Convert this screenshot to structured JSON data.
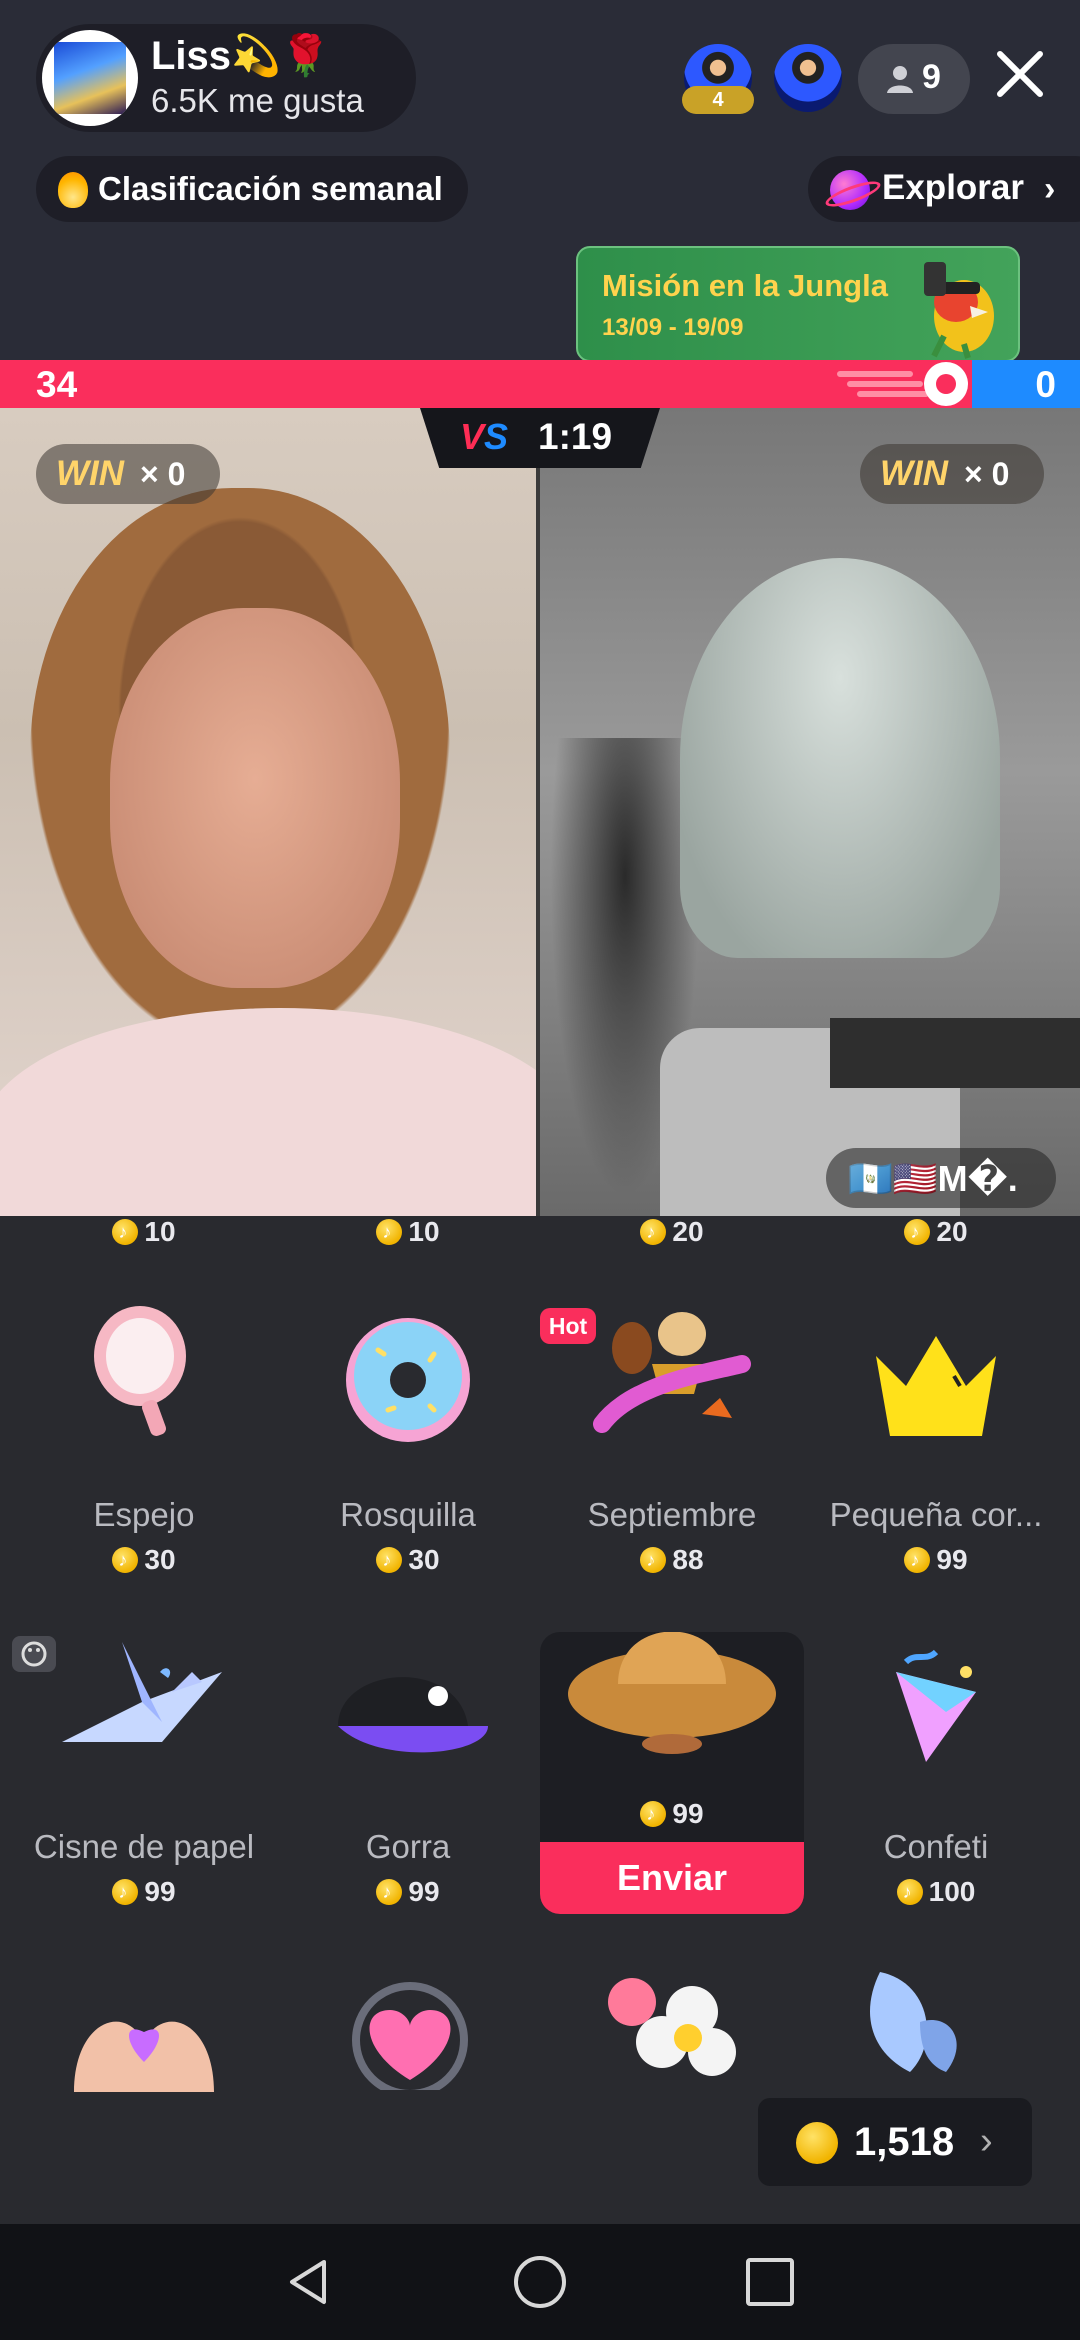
{
  "header": {
    "host_name": "Liss💫🌹",
    "host_likes": "6.5K me gusta",
    "viewer_rank": "4",
    "viewer_count": "9",
    "ranking_label": "Clasificación semanal",
    "explore_label": "Explorar",
    "mission_title": "Misión en la Jungla",
    "mission_dates": "13/09 - 19/09"
  },
  "battle": {
    "score_left": "34",
    "score_right": "0",
    "vs_label": "VS",
    "timer": "1:19",
    "win_left_word": "WIN",
    "win_left_count": "× 0",
    "win_right_word": "WIN",
    "win_right_count": "× 0",
    "opponent_tag": "🇬🇹🇺🇸M�."
  },
  "gifts": {
    "top_prices": [
      "10",
      "10",
      "20",
      "20"
    ],
    "row1": [
      {
        "name": "Espejo",
        "price": "30"
      },
      {
        "name": "Rosquilla",
        "price": "30"
      },
      {
        "name": "Septiembre",
        "price": "88"
      },
      {
        "name": "Pequeña cor...",
        "price": "99"
      }
    ],
    "row2": [
      {
        "name": "Cisne de papel",
        "price": "99"
      },
      {
        "name": "Gorra",
        "price": "99"
      },
      {
        "name": "",
        "price": "99"
      },
      {
        "name": "Confeti",
        "price": "100"
      }
    ],
    "hot_label": "Hot",
    "send_label": "Enviar",
    "balance": "1,518"
  },
  "colors": {
    "accent_red": "#fa2e5c",
    "accent_blue": "#1e8bff",
    "coin_gold": "#f1b400"
  }
}
